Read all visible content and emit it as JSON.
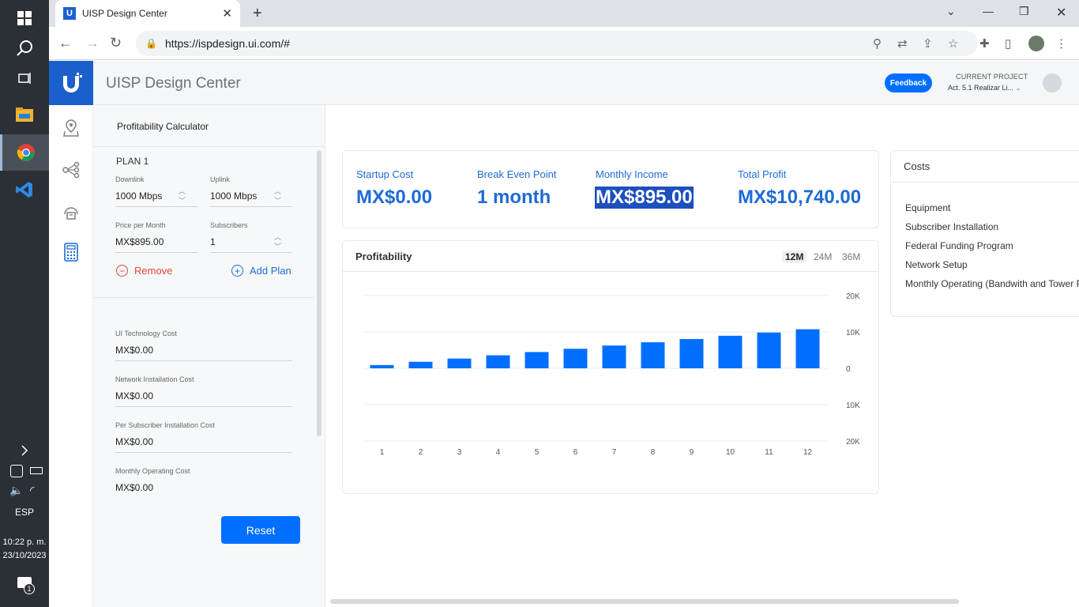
{
  "taskbar": {
    "lang": "ESP",
    "time": "10:22 p. m.",
    "date": "23/10/2023",
    "notification_count": "1"
  },
  "browser": {
    "tab_title": "UISP Design Center",
    "tab_favicon": "U",
    "url": "https://ispdesign.ui.com/#"
  },
  "header": {
    "app_title": "UISP Design Center",
    "feedback_label": "Feedback",
    "current_project_label": "CURRENT PROJECT",
    "current_project_value": "Act. 5.1 Realizar Li..."
  },
  "calculator": {
    "title": "Profitability Calculator",
    "plan_name": "PLAN 1",
    "downlink_label": "Downlink",
    "downlink_value": "1000 Mbps",
    "uplink_label": "Uplink",
    "uplink_value": "1000 Mbps",
    "price_label": "Price per Month",
    "price_value": "MX$895.00",
    "subscribers_label": "Subscribers",
    "subscribers_value": "1",
    "remove_label": "Remove",
    "add_plan_label": "Add Plan",
    "ui_tech_label": "UI Technology Cost",
    "ui_tech_value": "MX$0.00",
    "net_install_label": "Network Installation Cost",
    "net_install_value": "MX$0.00",
    "per_sub_label": "Per Subscriber Installation Cost",
    "per_sub_value": "MX$0.00",
    "monthly_op_label": "Monthly Operating Cost",
    "monthly_op_value": "MX$0.00",
    "reset_label": "Reset"
  },
  "kpis": {
    "startup_label": "Startup Cost",
    "startup_value": "MX$0.00",
    "breakeven_label": "Break Even Point",
    "breakeven_value": "1 month",
    "income_label": "Monthly Income",
    "income_value": "MX$895.00",
    "profit_label": "Total Profit",
    "profit_value": "MX$10,740.00"
  },
  "profitability": {
    "title": "Profitability",
    "ranges": [
      "12M",
      "24M",
      "36M"
    ],
    "selected_range": "12M"
  },
  "costs": {
    "title": "Costs",
    "items": [
      "Equipment",
      "Subscriber Installation",
      "Federal Funding Program",
      "Network Setup",
      "Monthly Operating (Bandwith and Tower Re"
    ]
  },
  "chart_data": {
    "type": "bar",
    "categories": [
      "1",
      "2",
      "3",
      "4",
      "5",
      "6",
      "7",
      "8",
      "9",
      "10",
      "11",
      "12"
    ],
    "values": [
      895,
      1790,
      2685,
      3580,
      4475,
      5370,
      6265,
      7160,
      8055,
      8950,
      9845,
      10740
    ],
    "y_tick_labels": [
      "20K",
      "10K",
      "0",
      "10K",
      "20K"
    ],
    "ylim": [
      -20000,
      20000
    ],
    "grid": true,
    "color": "#006fff"
  }
}
